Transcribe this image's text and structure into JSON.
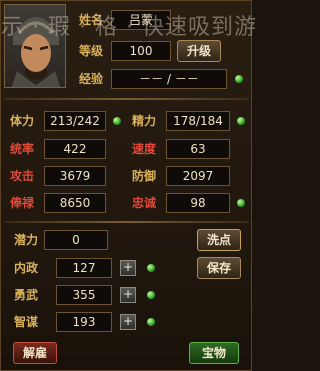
{
  "profile": {
    "name_label": "姓名",
    "name_value": "吕蒙",
    "level_label": "等级",
    "level_value": "100",
    "upgrade_label": "升级",
    "exp_label": "经验",
    "exp_value": "－－ / －－"
  },
  "stats": {
    "hp_label": "体力",
    "hp_value": "213/242",
    "mp_label": "精力",
    "mp_value": "178/184",
    "command_label": "统率",
    "command_value": "422",
    "speed_label": "速度",
    "speed_value": "63",
    "attack_label": "攻击",
    "attack_value": "3679",
    "defense_label": "防御",
    "defense_value": "2097",
    "salary_label": "俸禄",
    "salary_value": "8650",
    "loyalty_label": "忠诚",
    "loyalty_value": "98"
  },
  "points": {
    "potential_label": "潜力",
    "potential_value": "0",
    "reset_label": "洗点",
    "politics_label": "内政",
    "politics_value": "127",
    "martial_label": "勇武",
    "martial_value": "355",
    "intellect_label": "智谋",
    "intellect_value": "193",
    "save_label": "保存"
  },
  "footer": {
    "dismiss_label": "解雇",
    "treasure_label": "宝物"
  },
  "overlay_text": "示 · 瑕 · 格 · 快速吸到游",
  "colors": {
    "label_gold": "#d9b15a",
    "label_red": "#e04a3a",
    "green_dot": "#2c9a18"
  }
}
